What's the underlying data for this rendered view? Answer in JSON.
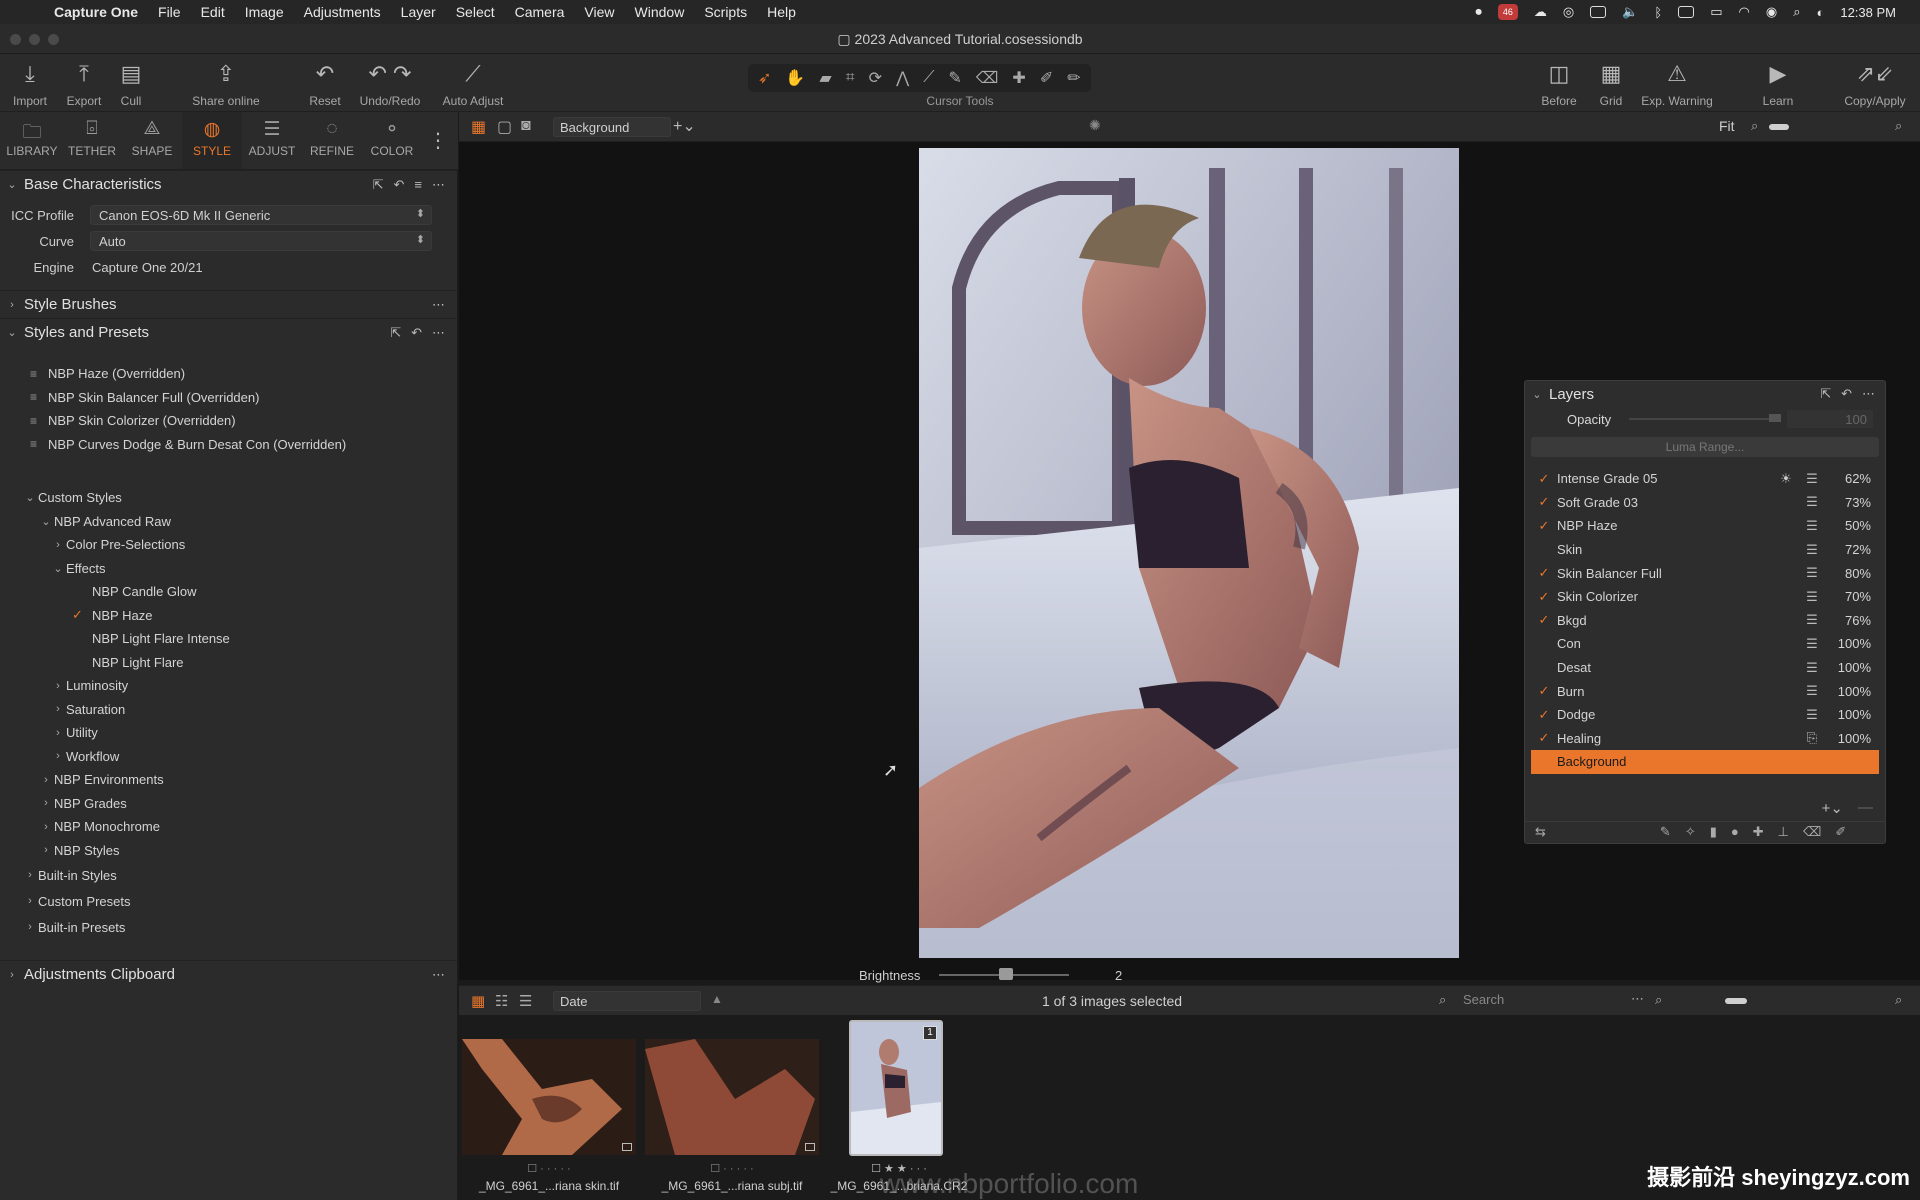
{
  "menubar": {
    "app_name": "Capture One",
    "items": [
      "File",
      "Edit",
      "Image",
      "Adjustments",
      "Layer",
      "Select",
      "Camera",
      "View",
      "Window",
      "Scripts",
      "Help"
    ],
    "badge_count": "46",
    "time": "12:38 PM"
  },
  "window": {
    "title": "2023 Advanced Tutorial.cosessiondb"
  },
  "toolbar": {
    "import": "Import",
    "export": "Export",
    "cull": "Cull",
    "share": "Share online",
    "reset": "Reset",
    "undo_redo": "Undo/Redo",
    "auto_adjust": "Auto Adjust",
    "cursor_tools": "Cursor Tools",
    "before": "Before",
    "grid": "Grid",
    "exp_warning": "Exp. Warning",
    "learn": "Learn",
    "copy_apply": "Copy/Apply"
  },
  "tool_tabs": [
    {
      "label": "LIBRARY",
      "icon": "folder-icon"
    },
    {
      "label": "TETHER",
      "icon": "camera-icon"
    },
    {
      "label": "SHAPE",
      "icon": "shape-icon"
    },
    {
      "label": "STYLE",
      "icon": "style-icon"
    },
    {
      "label": "ADJUST",
      "icon": "sliders-icon"
    },
    {
      "label": "REFINE",
      "icon": "refine-icon"
    },
    {
      "label": "COLOR",
      "icon": "color-icon"
    }
  ],
  "base": {
    "title": "Base Characteristics",
    "icc_label": "ICC Profile",
    "icc_value": "Canon EOS-6D Mk II Generic",
    "curve_label": "Curve",
    "curve_value": "Auto",
    "engine_label": "Engine",
    "engine_value": "Capture One 20/21"
  },
  "style_brushes": {
    "title": "Style Brushes"
  },
  "styles_presets": {
    "title": "Styles and Presets",
    "applied": [
      "NBP Haze (Overridden)",
      "NBP Skin Balancer Full (Overridden)",
      "NBP Skin Colorizer (Overridden)",
      "NBP Curves Dodge & Burn Desat Con (Overridden)"
    ],
    "tree": {
      "custom_styles": "Custom Styles",
      "nbp_advanced_raw": "NBP Advanced Raw",
      "color_preselections": "Color Pre-Selections",
      "effects": "Effects",
      "candle_glow": "NBP Candle Glow",
      "haze": "NBP Haze",
      "light_flare_intense": "NBP Light Flare Intense",
      "light_flare": "NBP Light Flare",
      "luminosity": "Luminosity",
      "saturation": "Saturation",
      "utility": "Utility",
      "workflow": "Workflow",
      "environments": "NBP Environments",
      "grades": "NBP Grades",
      "monochrome": "NBP Monochrome",
      "styles": "NBP Styles",
      "builtin_styles": "Built-in Styles",
      "custom_presets": "Custom Presets",
      "builtin_presets": "Built-in Presets"
    }
  },
  "adjustments_clipboard": {
    "title": "Adjustments Clipboard"
  },
  "viewer": {
    "layer_select": "Background",
    "fit": "Fit",
    "brightness_label": "Brightness",
    "brightness_value": "2"
  },
  "layers": {
    "title": "Layers",
    "opacity_label": "Opacity",
    "opacity_value": "100",
    "luma_range": "Luma Range...",
    "items": [
      {
        "name": "Intense Grade 05",
        "checked": true,
        "pct": "62%",
        "extra": "sun-icon"
      },
      {
        "name": "Soft Grade 03",
        "checked": true,
        "pct": "73%"
      },
      {
        "name": "NBP Haze",
        "checked": true,
        "pct": "50%"
      },
      {
        "name": "Skin",
        "checked": false,
        "pct": "72%"
      },
      {
        "name": "Skin Balancer Full",
        "checked": true,
        "pct": "80%"
      },
      {
        "name": "Skin Colorizer",
        "checked": true,
        "pct": "70%"
      },
      {
        "name": "Bkgd",
        "checked": true,
        "pct": "76%"
      },
      {
        "name": "Con",
        "checked": false,
        "pct": "100%"
      },
      {
        "name": "Desat",
        "checked": false,
        "pct": "100%"
      },
      {
        "name": "Burn",
        "checked": true,
        "pct": "100%"
      },
      {
        "name": "Dodge",
        "checked": true,
        "pct": "100%"
      },
      {
        "name": "Healing",
        "checked": true,
        "pct": "100%",
        "extra": "bandage-icon"
      }
    ],
    "selected": "Background"
  },
  "browser": {
    "sort": "Date",
    "selection_status": "1 of 3 images selected",
    "search_placeholder": "Search",
    "thumbs": [
      {
        "caption": "_MG_6961_...riana skin.tif"
      },
      {
        "caption": "_MG_6961_...riana subj.tif"
      },
      {
        "caption": "_MG_6961_...briana.CR2",
        "badge": "1"
      }
    ]
  },
  "watermark": {
    "text": "摄影前沿 sheyingzyz.com",
    "faint": "www.nbportfolio.com"
  }
}
